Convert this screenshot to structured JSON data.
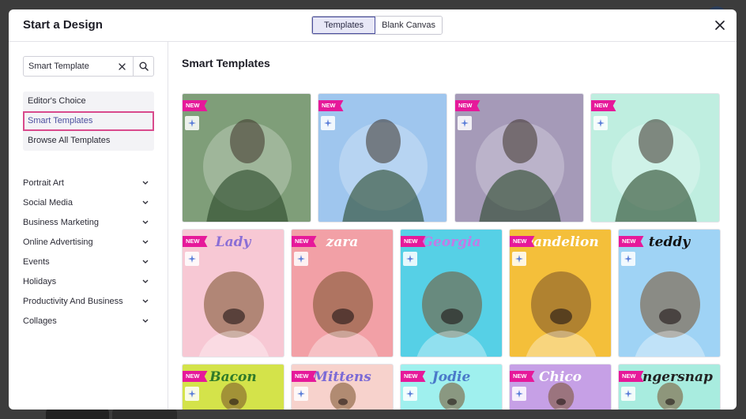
{
  "modal": {
    "title": "Start a Design",
    "tabs": [
      {
        "label": "Templates",
        "active": true
      },
      {
        "label": "Blank Canvas",
        "active": false
      }
    ]
  },
  "sidebar": {
    "search": {
      "value": "Smart Template",
      "placeholder": ""
    },
    "quick_links": [
      {
        "label": "Editor's Choice",
        "selected": false
      },
      {
        "label": "Smart Templates",
        "selected": true
      },
      {
        "label": "Browse All Templates",
        "selected": false
      }
    ],
    "categories": [
      {
        "label": "Portrait Art"
      },
      {
        "label": "Social Media"
      },
      {
        "label": "Business Marketing"
      },
      {
        "label": "Online Advertising"
      },
      {
        "label": "Events"
      },
      {
        "label": "Holidays"
      },
      {
        "label": "Productivity And Business"
      },
      {
        "label": "Collages"
      }
    ]
  },
  "main": {
    "title": "Smart Templates",
    "badge_label": "NEW",
    "row1": [
      {
        "name": "",
        "bg": "#7f9e79"
      },
      {
        "name": "",
        "bg": "#9fc6ee"
      },
      {
        "name": "",
        "bg": "#a59ab8"
      },
      {
        "name": "",
        "bg": "#bfeee0"
      }
    ],
    "row2": [
      {
        "name": "Lady",
        "bg": "#f7c8d4",
        "color": "#8b6fd6"
      },
      {
        "name": "zara",
        "bg": "#f2a0a6",
        "color": "#ffffff"
      },
      {
        "name": "Georgia",
        "bg": "#56d0e6",
        "color": "#c27be6"
      },
      {
        "name": "Dandelion",
        "bg": "#f4bf3a",
        "color": "#ffffff"
      },
      {
        "name": "teddy",
        "bg": "#9fd3f5",
        "color": "#111111"
      }
    ],
    "row3": [
      {
        "name": "Bacon",
        "bg": "#d4e34a",
        "color": "#2f7a2a"
      },
      {
        "name": "Mittens",
        "bg": "#f7d2cc",
        "color": "#7b6ad6"
      },
      {
        "name": "Jodie",
        "bg": "#9ff0ee",
        "color": "#4a79c9"
      },
      {
        "name": "Chico",
        "bg": "#c6a0e6",
        "color": "#ffffff"
      },
      {
        "name": "Gingersnap",
        "bg": "#a8ecdf",
        "color": "#222222"
      }
    ]
  }
}
